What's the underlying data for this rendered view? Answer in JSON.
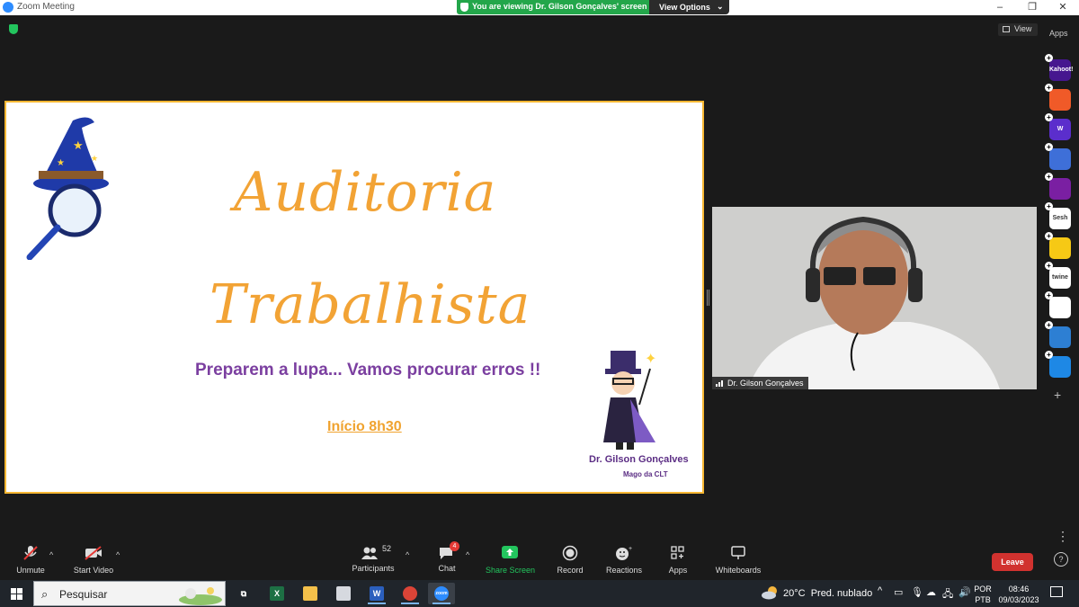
{
  "window": {
    "title": "Zoom Meeting"
  },
  "banner": {
    "viewing_text": "You are viewing Dr. Gilson Gonçalves' screen",
    "view_options": "View Options"
  },
  "top": {
    "view_label": "View",
    "apps_label": "Apps"
  },
  "apps": [
    {
      "name": "Kahoot!",
      "color": "#46178f",
      "label": "Kahoot!"
    },
    {
      "name": "app-orange",
      "color": "#f05a28",
      "label": ""
    },
    {
      "name": "Wooclap",
      "color": "#5b2ecc",
      "label": "W"
    },
    {
      "name": "app-blue-circle",
      "color": "#3e6fd8",
      "label": ""
    },
    {
      "name": "app-purple",
      "color": "#7a1fa2",
      "label": ""
    },
    {
      "name": "Sesh",
      "color": "#ffffff",
      "label": "Sesh"
    },
    {
      "name": "app-yellow",
      "color": "#f6c915",
      "label": ""
    },
    {
      "name": "twine",
      "color": "#ffffff",
      "label": "twine"
    },
    {
      "name": "app-multicolor",
      "color": "#ffffff",
      "label": ""
    },
    {
      "name": "app-sync",
      "color": "#2d7fd3",
      "label": ""
    },
    {
      "name": "app-blue-doc",
      "color": "#1e88e5",
      "label": ""
    }
  ],
  "slide": {
    "title_line1": "Auditoria",
    "title_line2": "Trabalhista",
    "subtitle": "Preparem a lupa... Vamos procurar erros !!",
    "start_time": "Início 8h30",
    "author": "Dr. Gilson Gonçalves",
    "author_role": "Mago da CLT"
  },
  "camera": {
    "participant_name": "Dr. Gilson Gonçalves"
  },
  "controls": {
    "unmute": "Unmute",
    "start_video": "Start Video",
    "participants": "Participants",
    "participants_count": "52",
    "chat": "Chat",
    "chat_badge": "4",
    "share_screen": "Share Screen",
    "record": "Record",
    "reactions": "Reactions",
    "apps": "Apps",
    "whiteboards": "Whiteboards",
    "leave": "Leave"
  },
  "taskbar": {
    "search_placeholder": "Pesquisar",
    "weather": "20°C  Pred. nublado",
    "lang_line1": "POR",
    "lang_line2": "PTB",
    "time": "08:46",
    "date": "09/03/2023"
  },
  "colors": {
    "share_green": "#23a64a",
    "leave_red": "#d1322f",
    "slide_orange": "#f2a335",
    "slide_purple": "#7b3fa0"
  }
}
